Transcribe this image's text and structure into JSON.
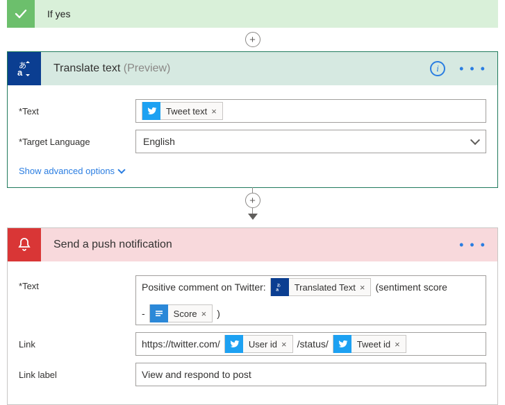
{
  "branch": {
    "label": "If yes"
  },
  "translate": {
    "title": "Translate text",
    "preview_suffix": "(Preview)",
    "fields": {
      "text_label": "Text",
      "text_token": "Tweet text",
      "target_label": "Target Language",
      "target_value": "English"
    },
    "advanced_link": "Show advanced options"
  },
  "push": {
    "title": "Send a push notification",
    "fields": {
      "text_label": "Text",
      "text_parts": {
        "prefix": "Positive comment on Twitter: ",
        "translated_token": "Translated Text",
        "mid1": " (sentiment score ",
        "score_dash": "- ",
        "score_token": "Score",
        "suffix": " )"
      },
      "link_label": "Link",
      "link_parts": {
        "prefix": "https://twitter.com/ ",
        "userid_token": "User id",
        "mid": " /status/ ",
        "tweetid_token": "Tweet id"
      },
      "linklabel_label": "Link label",
      "linklabel_value": "View and respond to post"
    }
  },
  "symbols": {
    "x": "×",
    "plus": "+",
    "info": "i",
    "ellipsis": "• • •"
  }
}
